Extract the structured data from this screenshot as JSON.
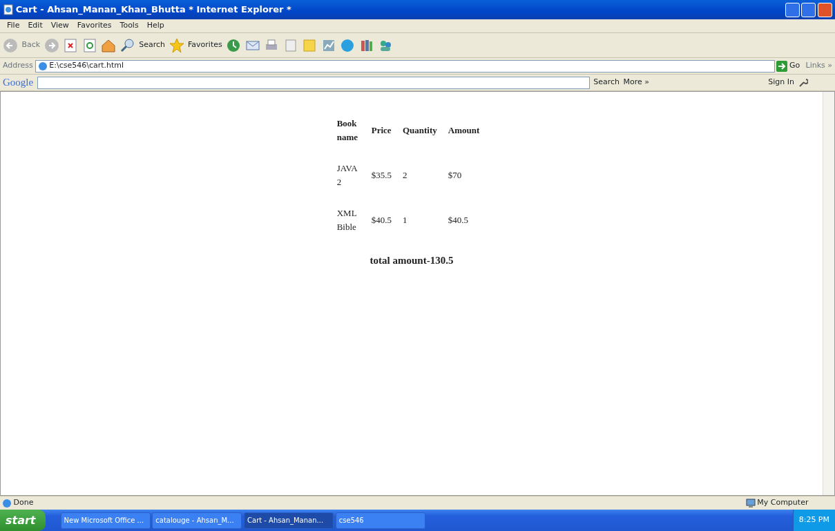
{
  "window": {
    "title": "Cart - Ahsan_Manan_Khan_Bhutta * Internet Explorer *"
  },
  "menu": [
    "File",
    "Edit",
    "View",
    "Favorites",
    "Tools",
    "Help"
  ],
  "toolbar": {
    "back": "Back",
    "search": "Search",
    "favorites": "Favorites"
  },
  "address": {
    "label": "Address",
    "value": "E:\\cse546\\cart.html",
    "go": "Go",
    "links": "Links »"
  },
  "google_bar": {
    "logo": "Google",
    "search": "Search",
    "more": "More »",
    "sign_in": "Sign In"
  },
  "table": {
    "columns": [
      "Book name",
      "Price",
      "Quantity",
      "Amount"
    ],
    "rows": [
      [
        "JAVA 2",
        "$35.5",
        "2",
        "$70"
      ],
      [
        "XML Bible",
        "$40.5",
        "1",
        "$40.5"
      ]
    ]
  },
  "total": "total amount-130.5",
  "status_bar": {
    "text": "Done",
    "zone": "My Computer"
  },
  "taskbar": {
    "start": "start",
    "tasks": [
      {
        "label": "New Microsoft Office ...",
        "selected": false
      },
      {
        "label": "catalouge - Ahsan_M...",
        "selected": false
      },
      {
        "label": "Cart - Ahsan_Manan...",
        "selected": true
      },
      {
        "label": "cse546",
        "selected": false
      }
    ],
    "clock": "8:25 PM"
  }
}
